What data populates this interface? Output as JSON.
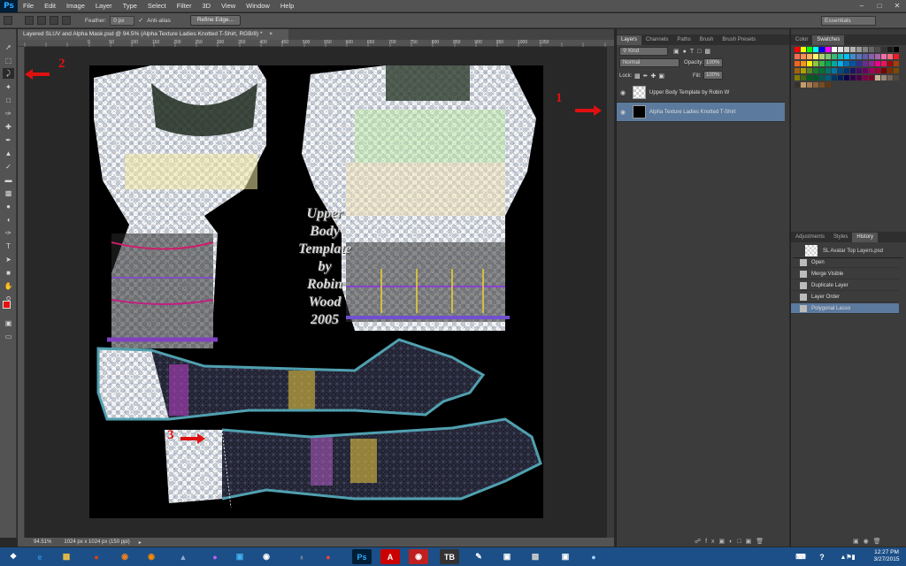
{
  "app": {
    "logo": "Ps"
  },
  "menu": [
    "File",
    "Edit",
    "Image",
    "Layer",
    "Type",
    "Select",
    "Filter",
    "3D",
    "View",
    "Window",
    "Help"
  ],
  "options": {
    "feather_label": "Feather:",
    "feather_value": "0 px",
    "antialias_label": "Anti-alias",
    "refine_edge": "Refine Edge...",
    "workspace": "Essentials"
  },
  "document": {
    "tab_title": "Layered SLUV and Alpha Mask.psd @ 94.5% (Alpha Texture Ladies Knotted T-Shirt, RGB/8) *",
    "zoom": "94.51%",
    "doc_size": "1024 px x 1024 px (150 ppi)"
  },
  "ruler_ticks": [
    "0",
    "50",
    "100",
    "150",
    "200",
    "250",
    "300",
    "350",
    "400",
    "450",
    "500",
    "550",
    "600",
    "650",
    "700",
    "750",
    "800",
    "850",
    "900",
    "950",
    "1000",
    "1050"
  ],
  "canvas_text": {
    "lines": [
      "Upper",
      "Body",
      "Template",
      "by",
      "Robin",
      "Wood",
      "2005"
    ]
  },
  "annotations": {
    "one": "1",
    "two": "2",
    "three": "3"
  },
  "layers_panel": {
    "tabs": [
      "Layers",
      "Channels",
      "Paths",
      "Brush",
      "Brush Presets"
    ],
    "kind_filter": "Kind",
    "blend_mode": "Normal",
    "opacity_label": "Opacity:",
    "opacity_value": "100%",
    "lock_label": "Lock:",
    "fill_label": "Fill:",
    "fill_value": "100%",
    "layers": [
      {
        "name": "Upper Body Template by Robin W",
        "selected": false
      },
      {
        "name": "Alpha Texture Ladies Knotted T-Shirt",
        "selected": true
      }
    ]
  },
  "color_panel": {
    "tabs": [
      "Color",
      "Swatches"
    ]
  },
  "swatch_colors": [
    "#ff0000",
    "#ffff00",
    "#00ff00",
    "#00ffff",
    "#0000ff",
    "#ff00ff",
    "#ffffff",
    "#e6e6e6",
    "#cccccc",
    "#b3b3b3",
    "#999999",
    "#808080",
    "#666666",
    "#4d4d4d",
    "#333333",
    "#1a1a1a",
    "#000000",
    "#f26c4f",
    "#f68e56",
    "#fbaf5d",
    "#fff568",
    "#acd373",
    "#7cc576",
    "#3bb878",
    "#1abbb4",
    "#00bff3",
    "#438ccb",
    "#5574b9",
    "#605ca8",
    "#855fa8",
    "#a763a8",
    "#f06ea9",
    "#f26d7d",
    "#ed1c24",
    "#f26522",
    "#f7941d",
    "#fff200",
    "#8dc63f",
    "#39b54a",
    "#00a651",
    "#00a99d",
    "#00aeef",
    "#0072bc",
    "#0054a6",
    "#2e3192",
    "#662d91",
    "#92278f",
    "#ec008c",
    "#ed145b",
    "#9e0b0f",
    "#a0410d",
    "#a3620a",
    "#aba000",
    "#598527",
    "#197b30",
    "#007236",
    "#00746b",
    "#0076a3",
    "#004a80",
    "#003471",
    "#1b1464",
    "#440e62",
    "#630460",
    "#9e005d",
    "#9e0039",
    "#790000",
    "#7b2e00",
    "#7d4900",
    "#827b00",
    "#406618",
    "#005e20",
    "#005826",
    "#005952",
    "#005b7f",
    "#003663",
    "#002157",
    "#0d004c",
    "#32004b",
    "#4b0049",
    "#7b0046",
    "#7a0026",
    "#c7b299",
    "#998675",
    "#736357",
    "#534741",
    "#37302a",
    "#c69c6d",
    "#a67c52",
    "#8c6239",
    "#754c24",
    "#603913"
  ],
  "history_panel": {
    "tabs": [
      "Adjustments",
      "Styles",
      "History"
    ],
    "snapshot": "SL Avatar Top Layers.psd",
    "states": [
      "Open",
      "Merge Visible",
      "Duplicate Layer",
      "Layer Order",
      "Polygonal Lasso"
    ],
    "selected_index": 4
  },
  "taskbar": {
    "time": "12:27 PM",
    "date": "3/27/2015"
  },
  "colors": {
    "foreground": "#e81010",
    "background": "#ffffff",
    "accent_selected": "#5b7a9d"
  }
}
